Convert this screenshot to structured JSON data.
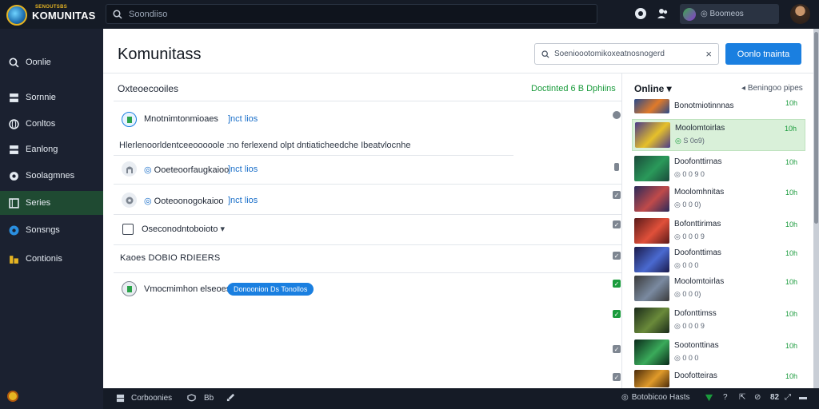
{
  "app": {
    "brand_sub": "SENOUTSBS",
    "brand_name": "KOMUNITAS",
    "search_placeholder": "Soondiiso",
    "user_status": "Boomeos"
  },
  "sidebar": {
    "items": [
      {
        "label": "Oonlie",
        "icon": "search-icon"
      },
      {
        "label": "Sornnie",
        "icon": "grid-icon"
      },
      {
        "label": "Conltos",
        "icon": "globe-icon"
      },
      {
        "label": "Eanlong",
        "icon": "grid-icon"
      },
      {
        "label": "Soolagmnes",
        "icon": "compass-icon"
      },
      {
        "label": "Series",
        "icon": "bookmark-icon",
        "active": true
      },
      {
        "label": "Sonsngs",
        "icon": "chat-icon"
      },
      {
        "label": "Contionis",
        "icon": "folder-icon"
      }
    ]
  },
  "main": {
    "title": "Komunitass",
    "filter_value": "Soenioootomikoxeatnosnogerd",
    "primary_button": "Oonlo tnainta",
    "list_header": "Oxteoecooiles",
    "list_count": "Doctinted 6 B Dphiins",
    "rows": [
      {
        "title": "Mnotnimtonmioaes",
        "tag": "]nct lios"
      },
      {
        "title": "Ooeteoorfaugkaioo",
        "tag": "]nct lios"
      },
      {
        "title": "Ooteoonogokaioo",
        "tag": "]nct lios"
      }
    ],
    "description": "Hlerlenoorldentceeooooole :no ferlexend olpt dntiaticheedche Ibeatvlocnhe",
    "select_value": "Oseconodntoboioto",
    "section_label": "Kaoes DOBIO RDIEERS",
    "last_row_title": "Vmocmimhon elseoes",
    "last_row_badge": "Donoonion Ds Tonollos"
  },
  "online": {
    "label": "Online",
    "sort_label": "Beningoo pipes",
    "friends": [
      {
        "name": "Bonotmiotinnnas",
        "sub": "",
        "time": "10h",
        "color1": "#2a4a8a",
        "color2": "#e07a2a"
      },
      {
        "name": "Moolomtoirlas",
        "sub": "S 0o9)",
        "time": "10h",
        "color1": "#4a3a8a",
        "color2": "#e6c02a",
        "highlight": true
      },
      {
        "name": "Doofonttirnas",
        "sub": "0 0 9 0",
        "time": "10h",
        "color1": "#1a4a3a",
        "color2": "#2a9a5a"
      },
      {
        "name": "Moolomhnitas",
        "sub": "0 0 0)",
        "time": "10h",
        "color1": "#2a2a5a",
        "color2": "#c04a4a"
      },
      {
        "name": "Bofonttirimas",
        "sub": "0 0 0 9",
        "time": "10h",
        "color1": "#5a1a1a",
        "color2": "#e0503a"
      },
      {
        "name": "Doofonttimas",
        "sub": "0 0 0",
        "time": "10h",
        "color1": "#1a1a4a",
        "color2": "#4a6ad0"
      },
      {
        "name": "Moolomtoirlas",
        "sub": "0 0 0)",
        "time": "10h",
        "color1": "#3a3a3a",
        "color2": "#7a8aa0"
      },
      {
        "name": "Dofonttimss",
        "sub": "0 0 0 9",
        "time": "10h",
        "color1": "#1a2a1a",
        "color2": "#6a8a3a"
      },
      {
        "name": "Sootonttinas",
        "sub": "0 0 0",
        "time": "10h",
        "color1": "#0a2a1a",
        "color2": "#3aaa5a"
      },
      {
        "name": "Doofotteiras",
        "sub": "",
        "time": "10h",
        "color1": "#4a2a0a",
        "color2": "#e09a2a"
      }
    ]
  },
  "footer": {
    "left_label": "Corboonies",
    "mid_label": "Bb",
    "right_label": "Botobicoo Hasts",
    "right_count": "82"
  },
  "colors": {
    "accent": "#1a7fe0",
    "online_green": "#1a9b3c",
    "sidebar_active": "#1f4a32"
  }
}
